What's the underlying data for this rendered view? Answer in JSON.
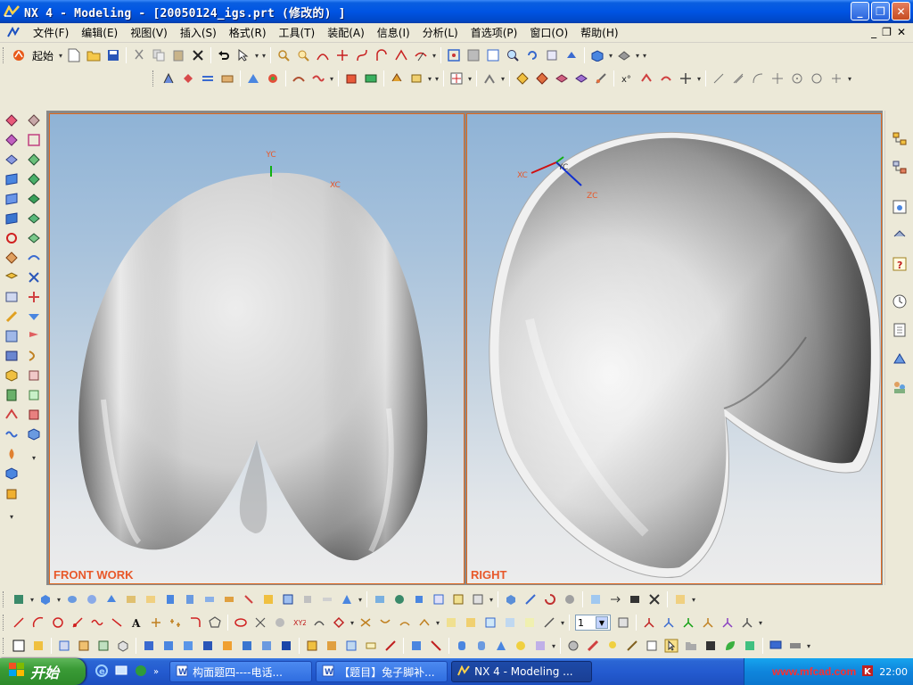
{
  "window": {
    "title": "NX 4 - Modeling - [20050124_igs.prt  (修改的) ]",
    "minimize": "_",
    "maximize": "❐",
    "close": "✕"
  },
  "menu": {
    "items": [
      "文件(F)",
      "编辑(E)",
      "视图(V)",
      "插入(S)",
      "格式(R)",
      "工具(T)",
      "装配(A)",
      "信息(I)",
      "分析(L)",
      "首选项(P)",
      "窗口(O)",
      "帮助(H)"
    ],
    "mdi": [
      "_",
      "❐",
      "✕"
    ]
  },
  "toolbar": {
    "start_label": "起始",
    "layer_value": "1"
  },
  "viewports": {
    "front_label": "FRONT WORK",
    "right_label": "RIGHT",
    "front_axes": {
      "yc": "YC",
      "xc": "XC"
    },
    "right_axes": {
      "xc": "XC",
      "yc": "YC",
      "zc": "ZC"
    }
  },
  "taskbar": {
    "start": "开始",
    "tasks": [
      "构面题四----电话...",
      "【题目】兔子脚补...",
      "NX 4 - Modeling ..."
    ],
    "watermark": "www.mfcad.com",
    "time": "22:00"
  },
  "colors": {
    "accent": "#0054e3",
    "viewport_border": "#e06a20",
    "label": "#e8582a",
    "axis_x": "#d01010",
    "axis_y": "#10b010",
    "axis_z": "#1030d0"
  }
}
